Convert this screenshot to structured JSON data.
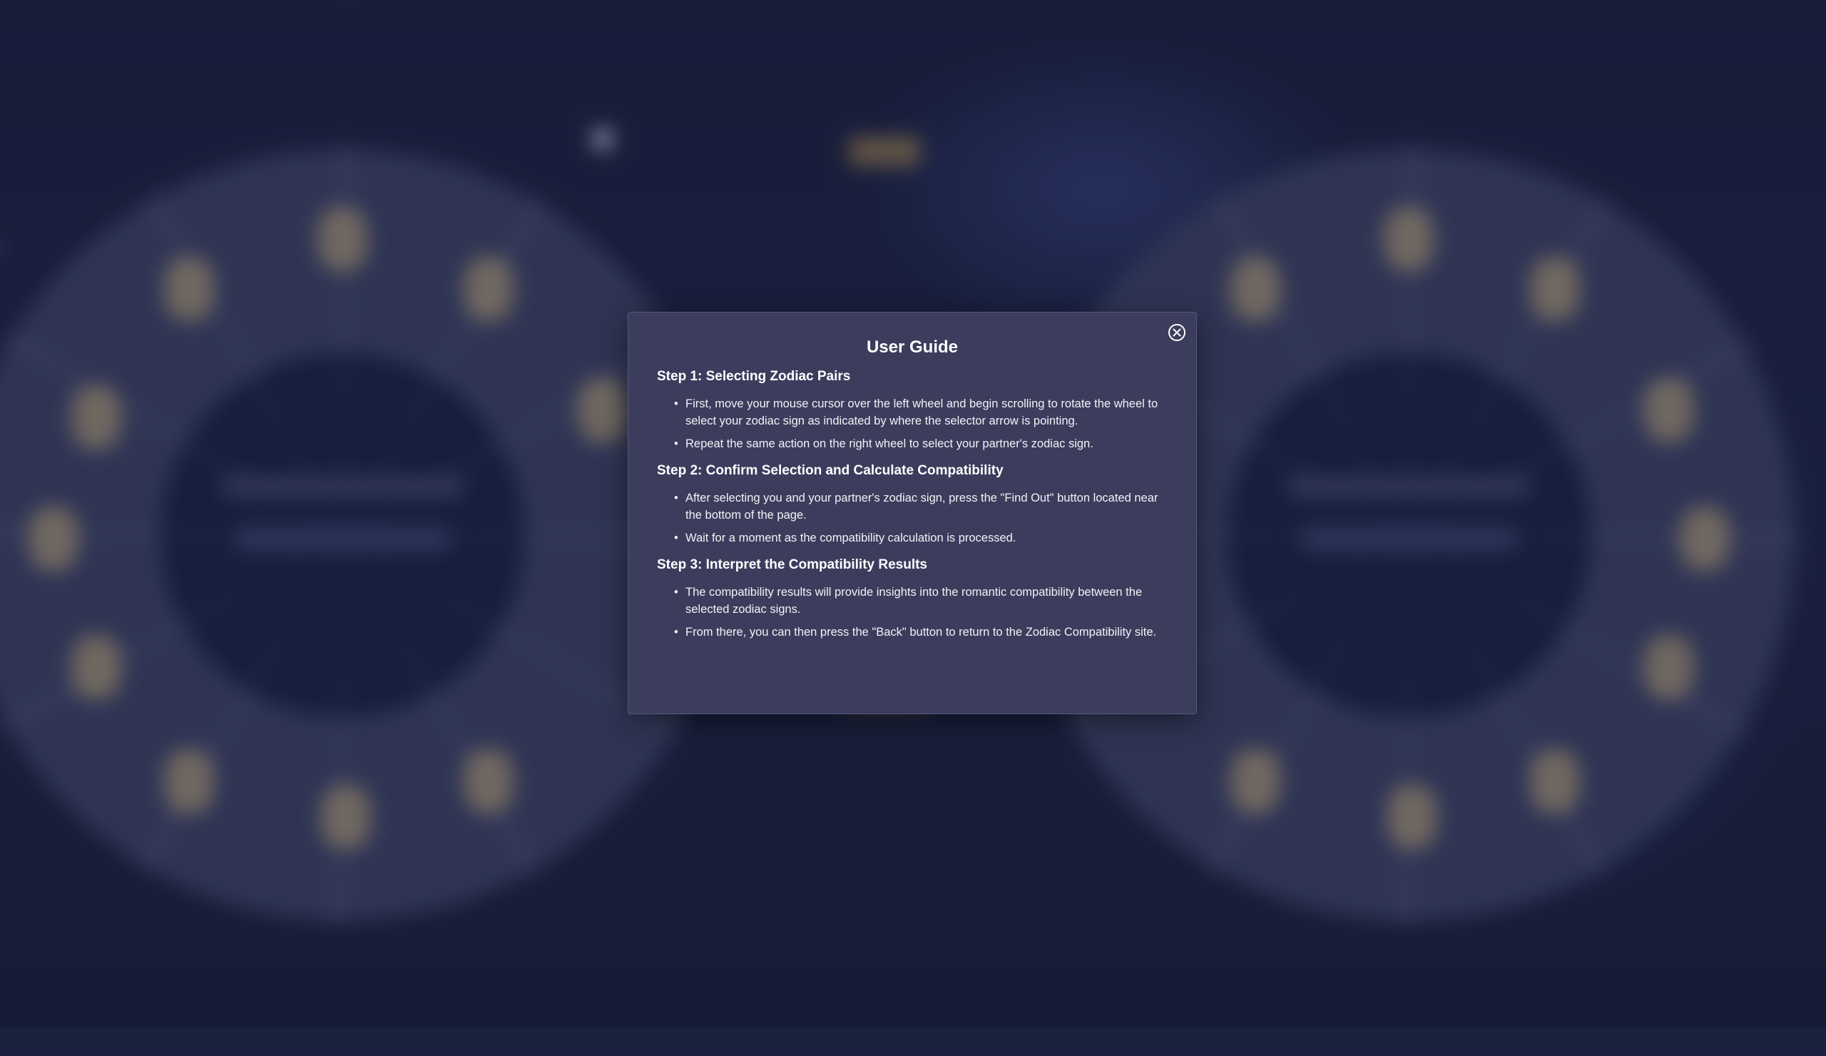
{
  "modal": {
    "title": "User Guide",
    "close_icon": "close-circle-icon",
    "steps": [
      {
        "heading": "Step 1: Selecting Zodiac Pairs",
        "items": [
          "First, move your mouse cursor over the left wheel and begin scrolling to rotate the wheel to select your zodiac sign as indicated by where the selector arrow is pointing.",
          "Repeat the same action on the right wheel to select your partner's zodiac sign."
        ]
      },
      {
        "heading": "Step 2: Confirm Selection and Calculate Compatibility",
        "items": [
          "After selecting you and your partner's zodiac sign, press the \"Find Out\" button located near the bottom of the page.",
          "Wait for a moment as the compatibility calculation is processed."
        ]
      },
      {
        "heading": "Step 3: Interpret the Compatibility Results",
        "items": [
          "The compatibility results will provide insights into the romantic compatibility between the selected zodiac signs.",
          "From there, you can then press the \"Back\" button to return to the Zodiac Compatibility site."
        ]
      }
    ]
  },
  "colors": {
    "modal_bg": "#3c3d5d",
    "page_bg": "#1b2140",
    "accent_gold": "#d2aa5a"
  }
}
